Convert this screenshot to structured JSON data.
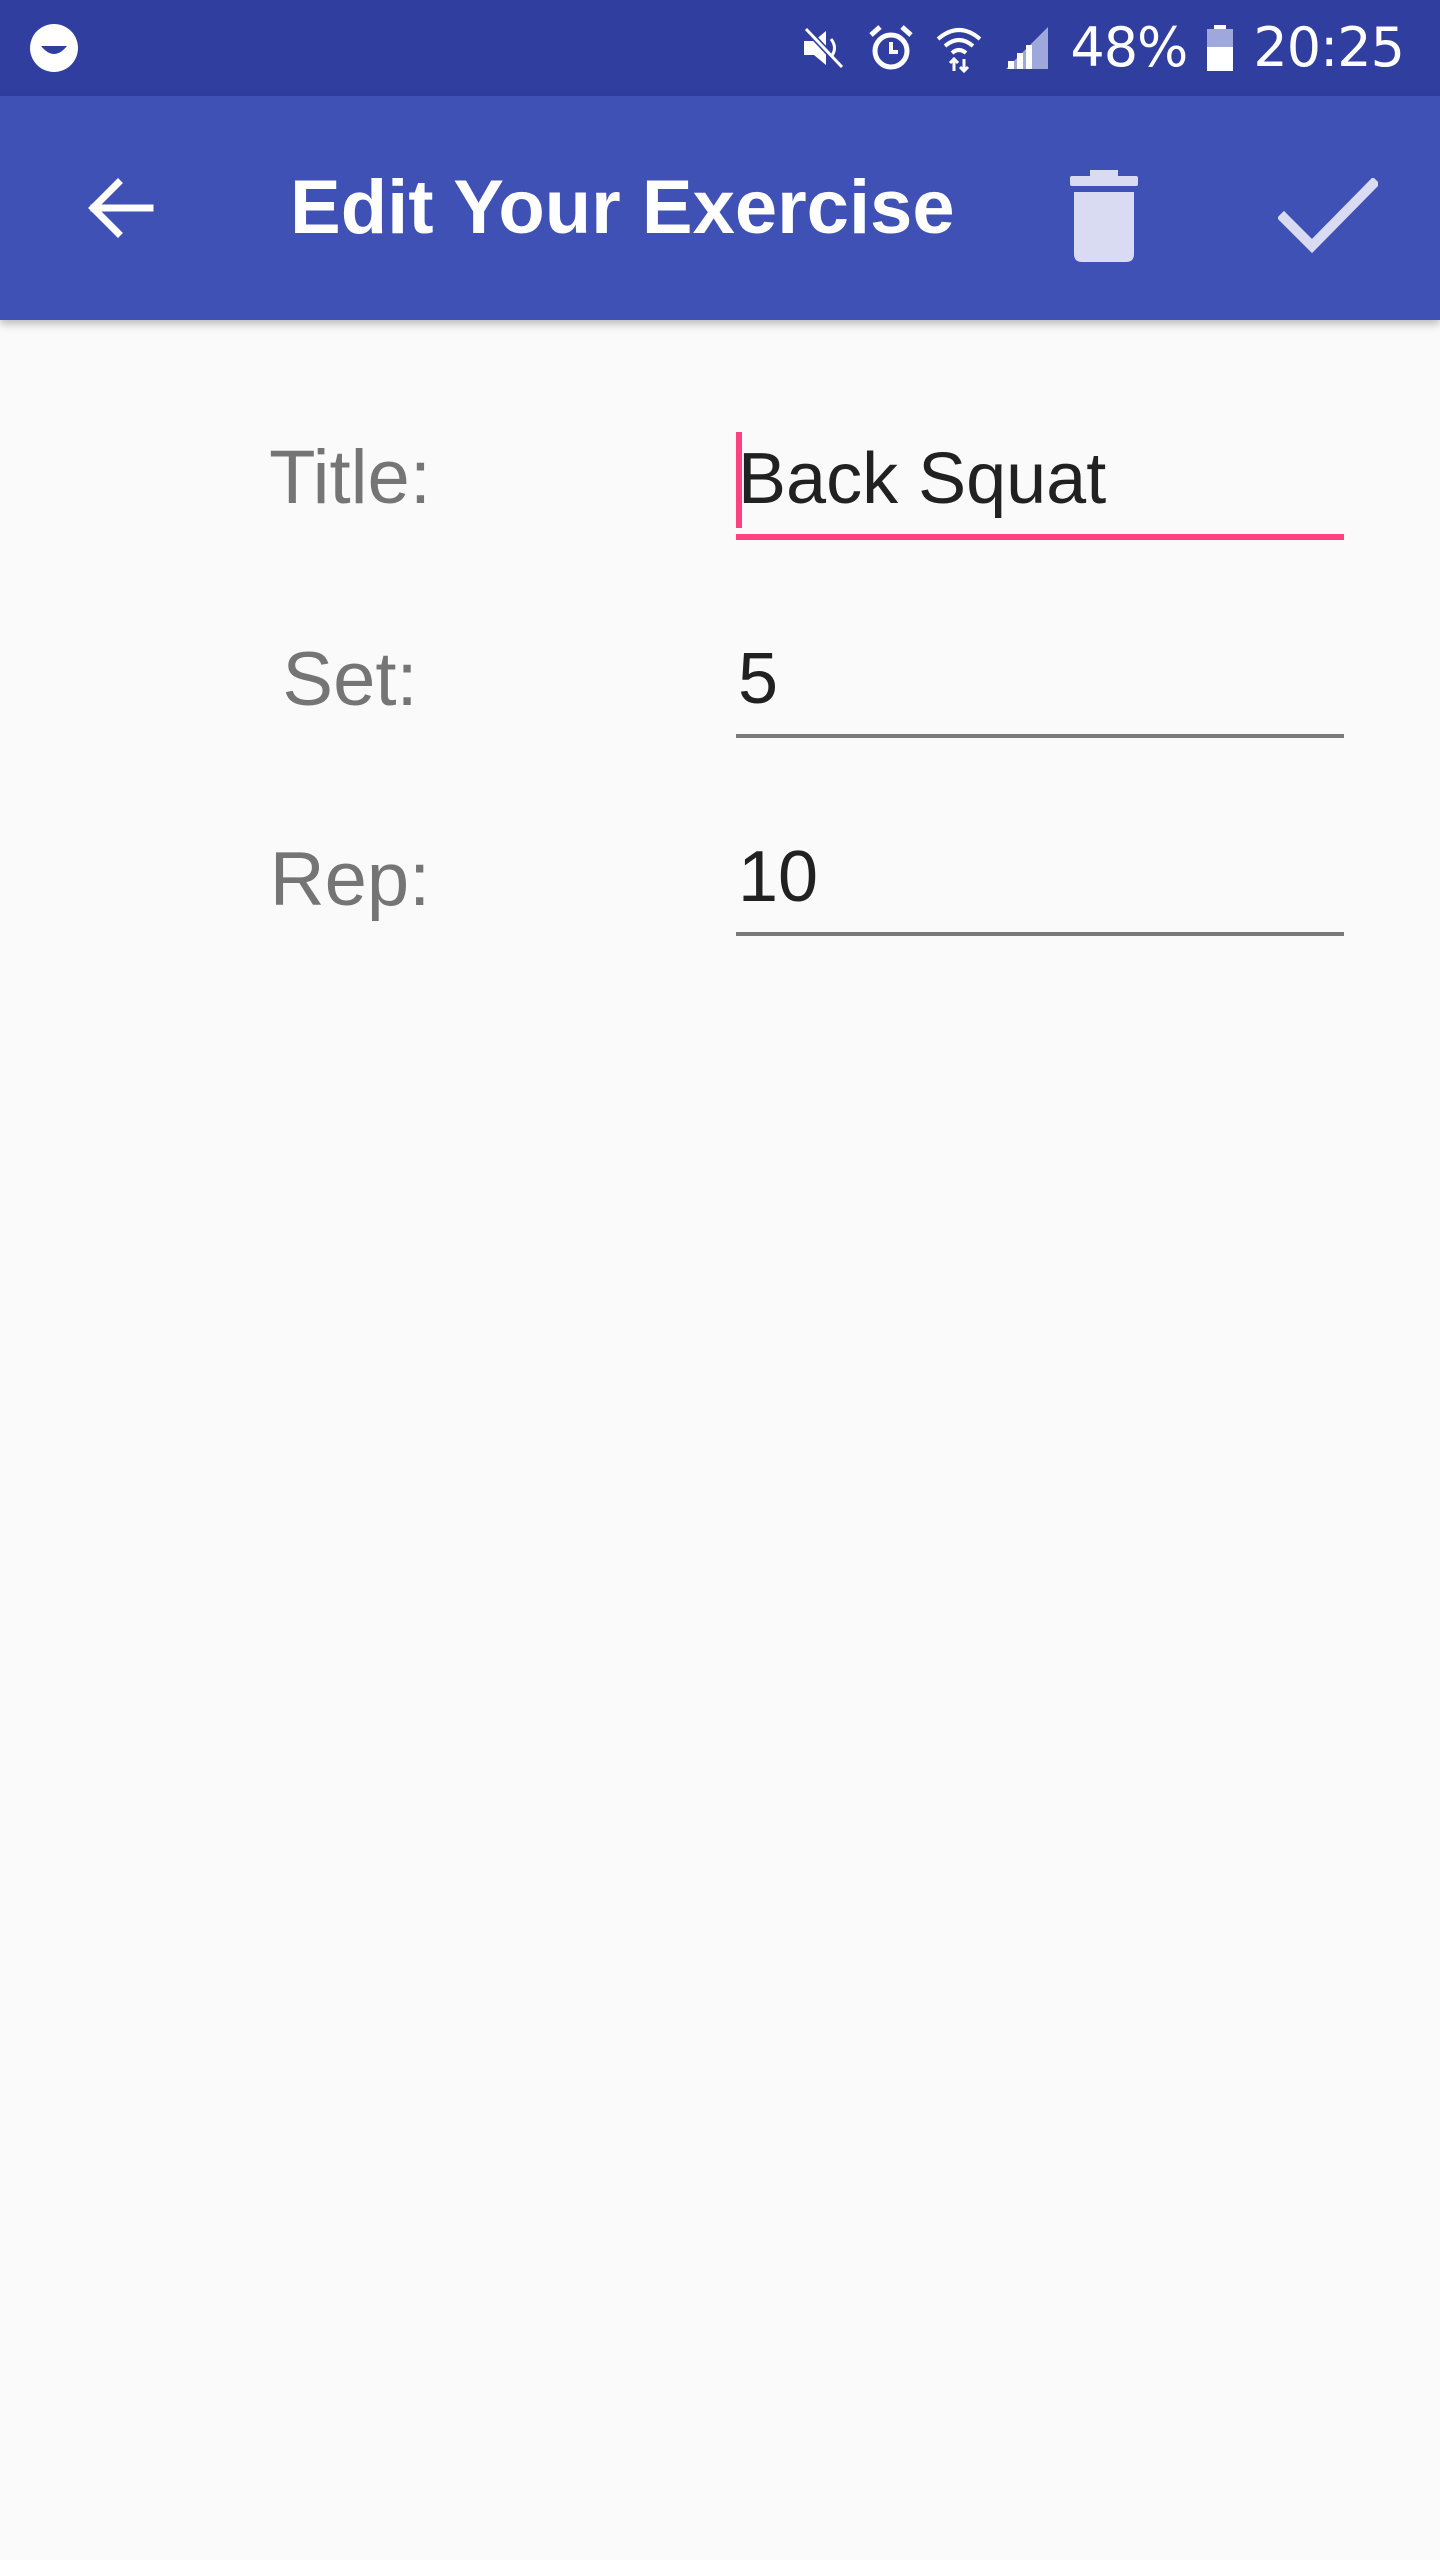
{
  "status_bar": {
    "battery_percent": "48%",
    "time": "20:25",
    "icons": [
      "notification-face-icon",
      "mute-icon",
      "alarm-icon",
      "wifi-icon",
      "signal-icon",
      "battery-icon"
    ]
  },
  "app_bar": {
    "title": "Edit Your Exercise",
    "back_icon": "arrow-back-icon",
    "delete_icon": "trash-icon",
    "confirm_icon": "check-icon",
    "colors": {
      "status_bar": "#303f9f",
      "primary": "#3f51b5",
      "accent": "#ff4081"
    }
  },
  "form": {
    "title_label": "Title:",
    "title_value": "Back Squat",
    "set_label": "Set:",
    "set_value": "5",
    "rep_label": "Rep:",
    "rep_value": "10"
  }
}
